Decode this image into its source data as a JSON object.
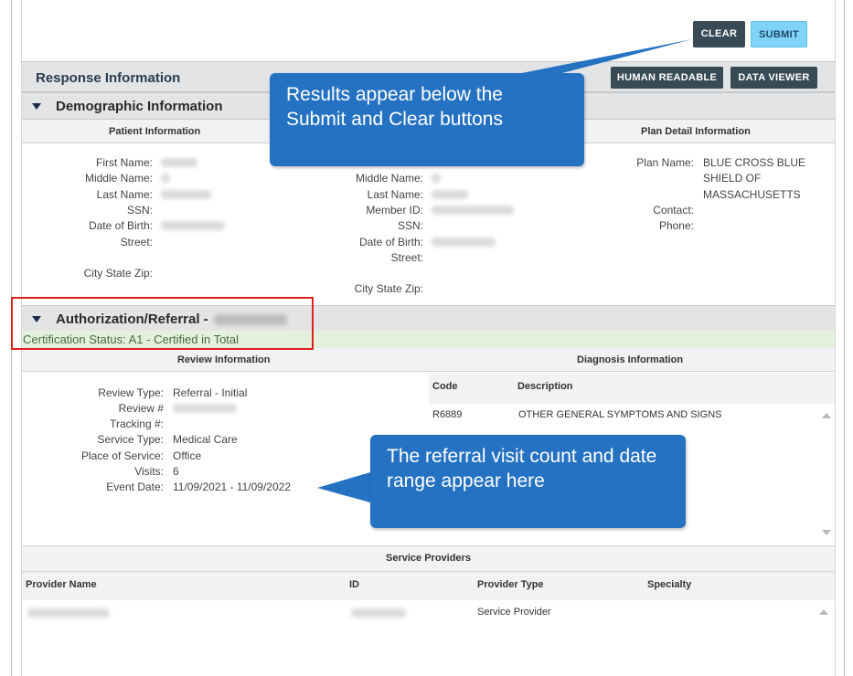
{
  "buttons": {
    "clear": "CLEAR",
    "submit": "SUBMIT",
    "human_readable": "HUMAN READABLE",
    "data_viewer": "DATA VIEWER"
  },
  "response": {
    "title": "Response Information"
  },
  "demographic": {
    "title": "Demographic Information",
    "col_patient": "Patient Information",
    "col_plan": "Plan Detail Information",
    "patient_labels": [
      "First Name:",
      "Middle Name:",
      "Last Name:",
      "SSN:",
      "Date of Birth:",
      "Street:",
      "City State Zip:"
    ],
    "subscriber_labels": [
      "Middle Name:",
      "Last Name:",
      "Member ID:",
      "SSN:",
      "Date of Birth:",
      "Street:",
      "City State Zip:"
    ],
    "plan": {
      "plan_name_label": "Plan Name:",
      "plan_name_lines": [
        "BLUE CROSS BLUE",
        "SHIELD OF",
        "MASSACHUSETTS"
      ],
      "contact_label": "Contact:",
      "phone_label": "Phone:"
    }
  },
  "authorization": {
    "title": "Authorization/Referral -",
    "cert_status": "Certification Status: A1 - Certified in Total",
    "col_review": "Review Information",
    "col_diagnosis": "Diagnosis Information",
    "review_labels": [
      "Review Type:",
      "Review #",
      "Tracking #:",
      "Service Type:",
      "Place of Service:",
      "Visits:",
      "Event Date:"
    ],
    "review_values": {
      "review_type": "Referral - Initial",
      "service_type": "Medical Care",
      "place_of_service": "Office",
      "visits": "6",
      "event_date": "11/09/2021 - 11/09/2022"
    },
    "diagnosis": {
      "headers": [
        "Code",
        "Description"
      ],
      "rows": [
        {
          "code": "R6889",
          "description": "OTHER GENERAL SYMPTOMS AND SIGNS"
        }
      ]
    }
  },
  "providers": {
    "title": "Service Providers",
    "headers": [
      "Provider Name",
      "ID",
      "Provider Type",
      "Specialty"
    ],
    "rows": [
      {
        "type": "Service Provider"
      }
    ]
  },
  "callouts": {
    "top": "Results appear below the Submit and Clear buttons",
    "bottom": "The referral visit count and date range appear here"
  },
  "colors": {
    "callout": "#2572c2",
    "highlight_box": "#e0201e",
    "cert_bg": "#e4f1dc",
    "dark_button": "#374a55",
    "submit_button": "#7fd3f7"
  }
}
